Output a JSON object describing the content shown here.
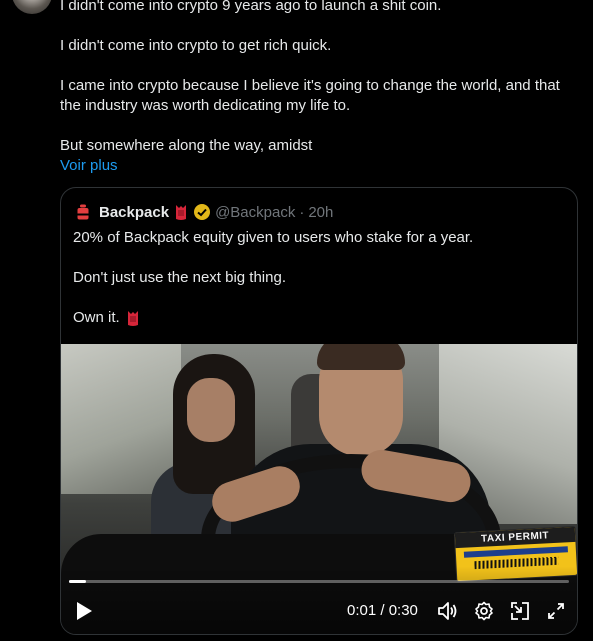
{
  "tweet": {
    "paragraphs": [
      "I didn't come into crypto 9 years ago to launch a shit coin.",
      "I didn't come into crypto to get rich quick.",
      "I came into crypto because I believe it's going to change the world, and that the industry was worth dedicating my life to.",
      "But somewhere along the way, amidst"
    ],
    "see_more": "Voir plus"
  },
  "quote": {
    "name": "Backpack",
    "handle": "@Backpack",
    "separator": "·",
    "time": "20h",
    "lines": [
      "20% of Backpack equity given to users who stake for a year.",
      "Don't just use the next big thing.",
      "Own it."
    ]
  },
  "video": {
    "current_time": "0:01",
    "duration": "0:30",
    "time_display": "0:01 / 0:30",
    "progress_fraction": 0.033,
    "permit_text": "TAXI PERMIT"
  },
  "colors": {
    "background": "#000000",
    "text": "#e7e9ea",
    "muted": "#71767b",
    "link": "#1d9bf0",
    "border": "#2f3336",
    "verified": "#e2b719",
    "backpack_red": "#e33e3f"
  },
  "icons": [
    "backpack-logo-icon",
    "backpack-emoji-icon",
    "verified-badge-icon",
    "play-icon",
    "volume-icon",
    "settings-icon",
    "pip-icon",
    "fullscreen-icon"
  ]
}
